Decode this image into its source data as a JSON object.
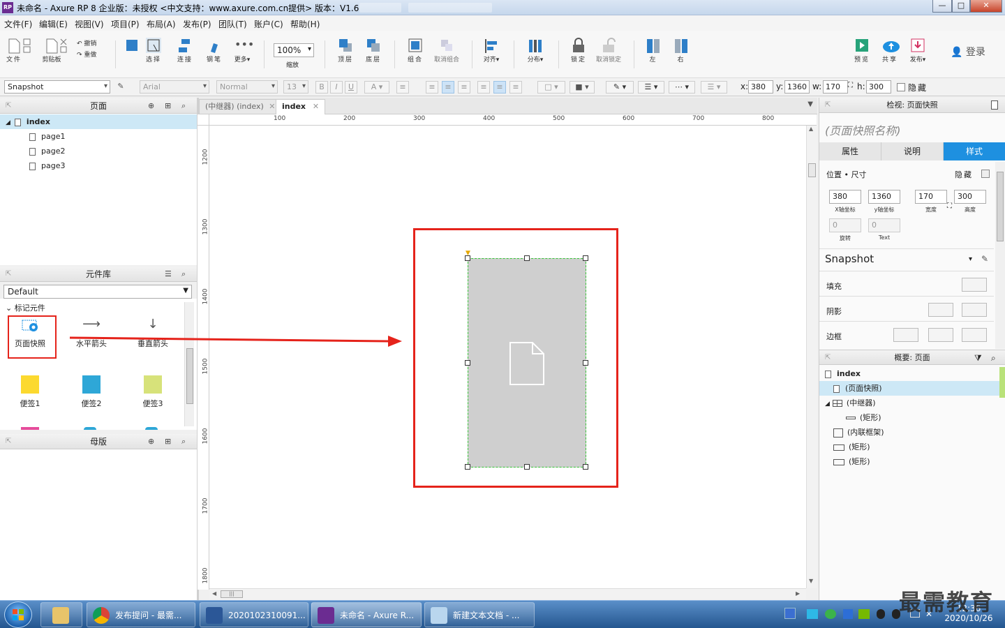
{
  "window": {
    "title": "未命名 - Axure RP 8 企业版：未授权    <中文支持：www.axure.com.cn提供> 版本：V1.6",
    "app_icon": "RP",
    "controls": {
      "minimize": "—",
      "maximize": "□",
      "close": "✕"
    }
  },
  "menu": [
    "文件(F)",
    "编辑(E)",
    "视图(V)",
    "项目(P)",
    "布局(A)",
    "发布(P)",
    "团队(T)",
    "账户(C)",
    "帮助(H)"
  ],
  "toolbar": {
    "file": "文件",
    "clipboard": "剪贴板",
    "undo": "撤销",
    "redo": "重做",
    "select": "选择",
    "connect": "连接",
    "pen": "钢笔",
    "more": "更多▾",
    "zoom_value": "100%",
    "zoom_label": "缩放",
    "top": "顶层",
    "bottom": "底层",
    "group": "组合",
    "ungroup": "取消组合",
    "align": "对齐▾",
    "distribute": "分布▾",
    "lock": "锁定",
    "unlock": "取消锁定",
    "left": "左",
    "right": "右",
    "preview": "预览",
    "share": "共享",
    "publish": "发布▾",
    "login": "登录"
  },
  "formatbar": {
    "style": "Snapshot",
    "font": "Arial",
    "weight": "Normal",
    "size": "13",
    "x_label": "x:",
    "x": "380",
    "y_label": "y:",
    "y": "1360",
    "w_label": "w:",
    "w": "170",
    "h_label": "h:",
    "h": "300",
    "hide": "隐藏"
  },
  "pages_panel": {
    "title": "页面",
    "root": "index",
    "children": [
      "page1",
      "page2",
      "page3"
    ]
  },
  "library_panel": {
    "title": "元件库",
    "selected_library": "Default",
    "group": "标记元件",
    "widgets": [
      "页面快照",
      "水平箭头",
      "垂直箭头",
      "便签1",
      "便签2",
      "便签3"
    ]
  },
  "masters_panel": {
    "title": "母版"
  },
  "canvas": {
    "tabs": [
      {
        "label": "(中继器) (index)",
        "close": "✕"
      },
      {
        "label": "index",
        "close": "✕"
      }
    ],
    "ruler_h": [
      "100",
      "200",
      "300",
      "400",
      "500",
      "600",
      "700",
      "800"
    ],
    "ruler_v": [
      "1200",
      "1300",
      "1400",
      "1500",
      "1600",
      "1700",
      "1800"
    ],
    "scroll_h": "|||"
  },
  "inspector": {
    "title": "检视: 页面快照",
    "name_placeholder": "(页面快照名称)",
    "tabs": [
      "属性",
      "说明",
      "样式"
    ],
    "section": "位置 • 尺寸",
    "hide": "隐藏",
    "x": "380",
    "x_label": "X轴坐标",
    "y": "1360",
    "y_label": "y轴坐标",
    "w": "170",
    "w_label": "宽度",
    "h": "300",
    "h_label": "高度",
    "rotate": "0",
    "rotate_label": "旋转",
    "text_rotate": "0",
    "text_label": "Text",
    "style_name": "Snapshot",
    "fill": "填充",
    "shadow": "阴影",
    "border": "边框"
  },
  "outline": {
    "title": "概要: 页面",
    "root": "index",
    "items": [
      "(页面快照)",
      "(中继器)",
      "(矩形)",
      "(内联框架)",
      "(矩形)",
      "(矩形)"
    ]
  },
  "taskbar": {
    "items": [
      "发布提问 - 最需...",
      "2020102310091...",
      "未命名 - Axure R...",
      "新建文本文档 - ..."
    ],
    "time": "12:36",
    "date": "2020/10/26"
  },
  "watermark": "最需教育",
  "colors": {
    "accent": "#1e90e0",
    "highlight_red": "#e5231b",
    "selection_green": "#35c435"
  }
}
